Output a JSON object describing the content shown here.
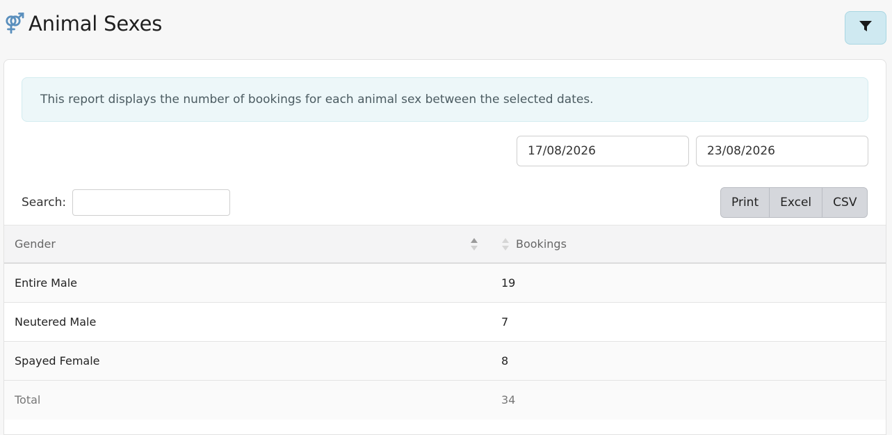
{
  "header": {
    "title": "Animal Sexes",
    "title_icon": "gender-icon",
    "filter_icon": "filter-icon"
  },
  "report": {
    "description": "This report displays the number of bookings for each animal sex between the selected dates.",
    "date_from": "17/08/2026",
    "date_to": "23/08/2026"
  },
  "search": {
    "label": "Search:",
    "value": ""
  },
  "export_buttons": {
    "print": "Print",
    "excel": "Excel",
    "csv": "CSV"
  },
  "table": {
    "columns": [
      "Gender",
      "Bookings"
    ],
    "rows": [
      {
        "gender": "Entire Male",
        "bookings": "19"
      },
      {
        "gender": "Neutered Male",
        "bookings": "7"
      },
      {
        "gender": "Spayed Female",
        "bookings": "8"
      }
    ],
    "total": {
      "label": "Total",
      "value": "34"
    }
  },
  "colors": {
    "accent": "#4a86b6",
    "filter_bg": "#cfe9f1",
    "alert_bg": "#edf7f9"
  }
}
